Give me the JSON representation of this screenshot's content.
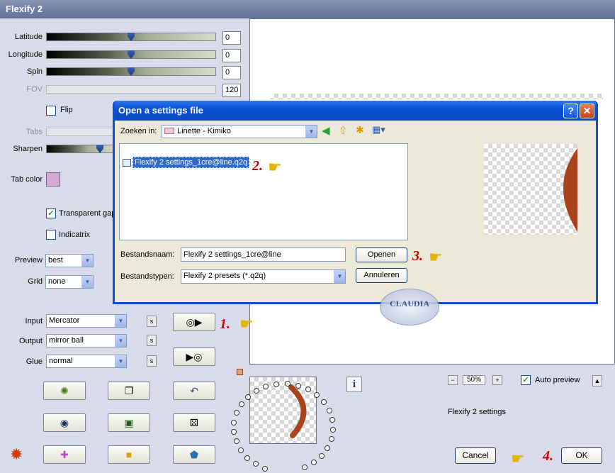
{
  "window": {
    "title": "Flexify 2"
  },
  "params": {
    "latitude": {
      "label": "Latitude",
      "value": "0"
    },
    "longitude": {
      "label": "Longitude",
      "value": "0"
    },
    "spin": {
      "label": "Spin",
      "value": "0"
    },
    "fov": {
      "label": "FOV",
      "value": "120"
    },
    "flip": {
      "label": "Flip",
      "checked": false
    },
    "tabs": {
      "label": "Tabs"
    },
    "sharpen": {
      "label": "Sharpen"
    },
    "tab_color": {
      "label": "Tab color",
      "color": "#d6a9d8"
    },
    "transparent_gaps": {
      "label": "Transparent gap",
      "checked": true
    },
    "indicatrix": {
      "label": "Indicatrix",
      "checked": false
    },
    "preview": {
      "label": "Preview",
      "value": "best"
    },
    "grid": {
      "label": "Grid",
      "value": "none"
    }
  },
  "io": {
    "input": {
      "label": "Input",
      "value": "Mercator"
    },
    "output": {
      "label": "Output",
      "value": "mirror ball"
    },
    "glue": {
      "label": "Glue",
      "value": "normal"
    },
    "s_label": "s"
  },
  "zoom": {
    "value": "50%",
    "minus": "−",
    "plus": "+"
  },
  "auto_preview": {
    "label": "Auto preview",
    "checked": true
  },
  "settings_label": "Flexify 2 settings",
  "info_label": "i",
  "footer": {
    "cancel": "Cancel",
    "ok": "OK"
  },
  "annotations": {
    "step1": "1.",
    "step2": "2.",
    "step3": "3.",
    "step4": "4.",
    "hand": "☛"
  },
  "watermark": "CLAUDIA",
  "dialog": {
    "title": "Open a settings file",
    "help_glyph": "?",
    "close_glyph": "✕",
    "look_in_label": "Zoeken in:",
    "look_in_value": "Linette - Kimiko",
    "file_item": "Flexify 2 settings_1cre@line.q2q",
    "filename_label": "Bestandsnaam:",
    "filename_value": "Flexify 2 settings_1cre@line",
    "filetype_label": "Bestandstypen:",
    "filetype_value": "Flexify 2 presets (*.q2q)",
    "open_button": "Openen",
    "cancel_button": "Annuleren"
  },
  "colors": {
    "panel": "#d9dbea",
    "dialog_frame": "#0d4fd3",
    "selection": "#316ac5",
    "annotation_red": "#d10000",
    "arc": "#a8431c"
  },
  "icons": [
    "play-file-icon",
    "play-arrow-icon",
    "bug-icon",
    "copy-icon",
    "undo-icon",
    "ring-icon",
    "square-icon",
    "dice-icon",
    "flame-icon",
    "cross-icon",
    "block-icon",
    "pentagon-icon",
    "back-icon",
    "up-folder-icon",
    "new-folder-icon",
    "view-menu-icon",
    "pointing-hand-icon",
    "folder-icon",
    "file-icon"
  ]
}
